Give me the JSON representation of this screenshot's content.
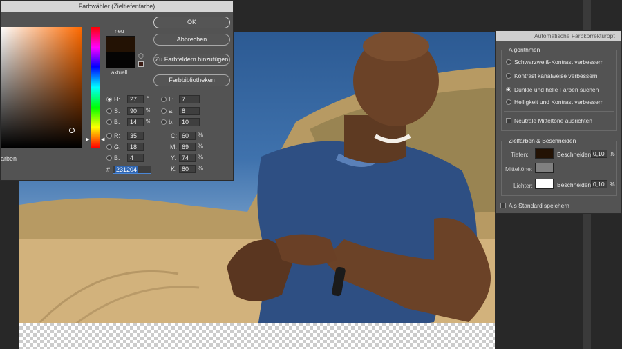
{
  "color_picker": {
    "title": "Farbwähler (Zieltiefenfarbe)",
    "new_label": "neu",
    "current_label": "aktuell",
    "new_color": "#231204",
    "current_color": "#050404",
    "left_edge_text": "arben",
    "buttons": {
      "ok": "OK",
      "cancel": "Abbrechen",
      "add_swatches": "Zu Farbfeldern hinzufügen",
      "libraries": "Farbbibliotheken"
    },
    "fields": {
      "H": {
        "label": "H:",
        "value": "27",
        "unit": "°"
      },
      "S": {
        "label": "S:",
        "value": "90",
        "unit": "%"
      },
      "Bv": {
        "label": "B:",
        "value": "14",
        "unit": "%"
      },
      "R": {
        "label": "R:",
        "value": "35"
      },
      "G": {
        "label": "G:",
        "value": "18"
      },
      "Bb": {
        "label": "B:",
        "value": "4"
      },
      "L": {
        "label": "L:",
        "value": "7"
      },
      "a": {
        "label": "a:",
        "value": "8"
      },
      "b": {
        "label": "b:",
        "value": "10"
      },
      "C": {
        "label": "C:",
        "value": "60",
        "unit": "%"
      },
      "M": {
        "label": "M:",
        "value": "69",
        "unit": "%"
      },
      "Y": {
        "label": "Y:",
        "value": "74",
        "unit": "%"
      },
      "K": {
        "label": "K:",
        "value": "80",
        "unit": "%"
      },
      "hex": {
        "label": "#",
        "value": "231204"
      }
    }
  },
  "auto_color": {
    "title": "Automatische Farbkorrekturopt",
    "algorithms_title": "Algorithmen",
    "algorithms": [
      {
        "label": "Schwarzweiß-Kontrast verbessern",
        "selected": false
      },
      {
        "label": "Kontrast kanalweise verbessern",
        "selected": false
      },
      {
        "label": "Dunkle und helle Farben suchen",
        "selected": true
      },
      {
        "label": "Helligkeit und Kontrast verbessern",
        "selected": false
      }
    ],
    "neutral_midtones": "Neutrale Mitteltöne ausrichten",
    "targets_title": "Zielfarben & Beschneiden",
    "shadows_label": "Tiefen:",
    "midtones_label": "Mitteltöne:",
    "highlights_label": "Lichter:",
    "clip_label": "Beschneiden:",
    "shadows_clip": "0,10",
    "highlights_clip": "0,10",
    "percent": "%",
    "shadows_color": "#231204",
    "midtones_color": "#808080",
    "highlights_color": "#ffffff",
    "save_default": "Als Standard speichern"
  }
}
